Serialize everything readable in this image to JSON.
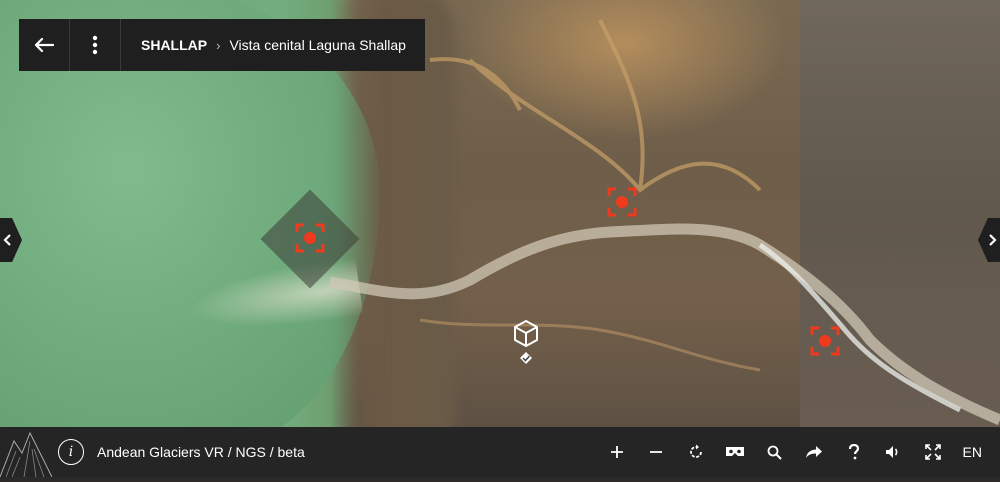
{
  "breadcrumb": {
    "parent": "SHALLAP",
    "separator": "›",
    "current": "Vista cenital Laguna Shallap"
  },
  "icons": {
    "back": "arrow-left-icon",
    "menu": "vertical-dots-icon",
    "nav_left": "chevron-left-icon",
    "nav_right": "chevron-right-icon",
    "hotspot": "target-hotspot-icon",
    "model": "cube-icon",
    "brand": "mountain-logo-icon",
    "info": "info-icon"
  },
  "footer": {
    "info_glyph": "i",
    "title": "Andean Glaciers VR / NGS / beta",
    "tools": [
      {
        "name": "zoom-in-button",
        "glyph": "+"
      },
      {
        "name": "zoom-out-button",
        "glyph": "−"
      },
      {
        "name": "autorotate-button",
        "glyph": "↻"
      },
      {
        "name": "vr-headset-button",
        "glyph": "vr"
      },
      {
        "name": "search-button",
        "glyph": "⌕"
      },
      {
        "name": "share-button",
        "glyph": "➦"
      },
      {
        "name": "help-button",
        "glyph": "?"
      },
      {
        "name": "sound-button",
        "glyph": "🔈"
      },
      {
        "name": "fullscreen-button",
        "glyph": "⤢"
      }
    ],
    "language": "EN"
  },
  "colors": {
    "hotspot": "#ef3a1e",
    "bar": "#1f1f1f",
    "text": "#ffffff"
  }
}
